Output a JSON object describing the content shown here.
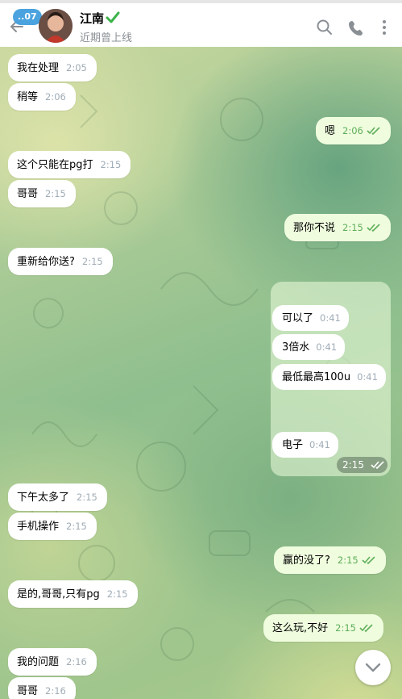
{
  "header": {
    "unread_badge": "..07",
    "name": "江南",
    "status": "近期曾上线"
  },
  "icons": [
    "back-arrow-icon",
    "verified-check-icon",
    "search-icon",
    "phone-icon",
    "more-vertical-icon",
    "chevron-down-icon",
    "double-check-icon"
  ],
  "colors": {
    "outgoing_bubble": "#effdde",
    "incoming_bubble": "#ffffff",
    "accent": "#4aa3df",
    "check": "#5fae5a"
  },
  "messages": [
    {
      "dir": "in",
      "text": "我在处理",
      "time": "2:05"
    },
    {
      "dir": "in",
      "text": "稍等",
      "time": "2:06"
    },
    {
      "dir": "out",
      "text": "嗯",
      "time": "2:06"
    },
    {
      "dir": "in",
      "text": "这个只能在pg打",
      "time": "2:15"
    },
    {
      "dir": "in",
      "text": "哥哥",
      "time": "2:15"
    },
    {
      "dir": "out",
      "text": "那你不说",
      "time": "2:15"
    },
    {
      "dir": "in",
      "text": "重新给你送?",
      "time": "2:15"
    }
  ],
  "album": {
    "items": [
      {
        "text": "可以了",
        "time": "0:41"
      },
      {
        "text": "3倍水",
        "time": "0:41"
      },
      {
        "text": "最低最高100u",
        "time": "0:41"
      },
      {
        "text": "电子",
        "time": "0:41"
      }
    ],
    "time": "2:15"
  },
  "messages2": [
    {
      "dir": "in",
      "text": "下午太多了",
      "time": "2:15"
    },
    {
      "dir": "in",
      "text": "手机操作",
      "time": "2:15"
    },
    {
      "dir": "out",
      "text": "赢的没了?",
      "time": "2:15"
    },
    {
      "dir": "in",
      "text": "是的,哥哥,只有pg",
      "time": "2:15"
    },
    {
      "dir": "out",
      "text": "这么玩,不好",
      "time": "2:15"
    },
    {
      "dir": "in",
      "text": "我的问题",
      "time": "2:16"
    },
    {
      "dir": "in",
      "text": "哥哥",
      "time": "2:16"
    }
  ]
}
